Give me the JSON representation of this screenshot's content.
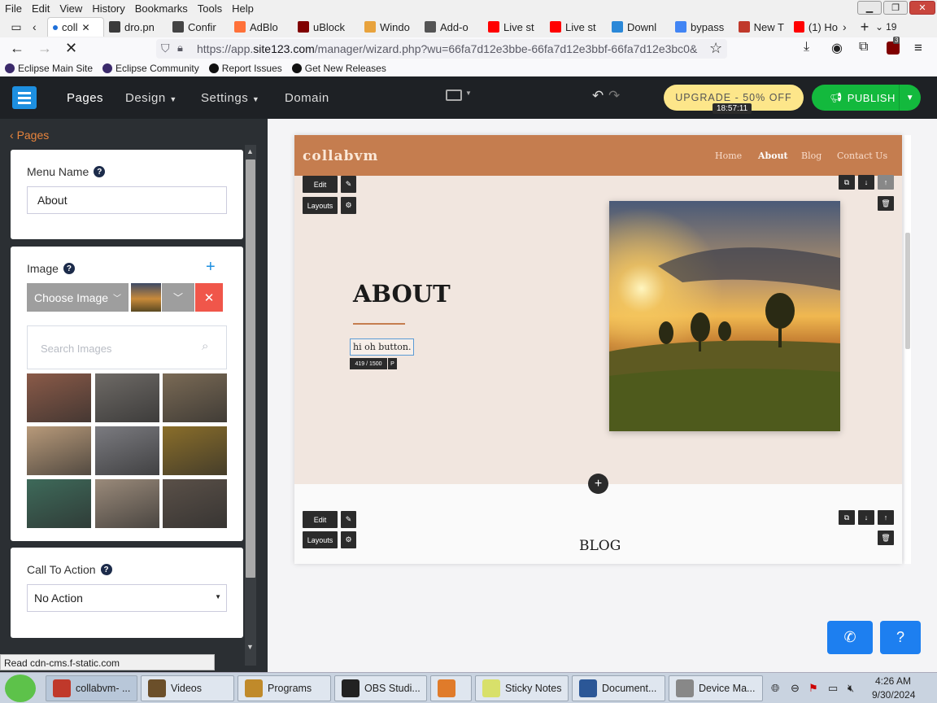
{
  "menubar": {
    "items": [
      "File",
      "Edit",
      "View",
      "History",
      "Bookmarks",
      "Tools",
      "Help"
    ]
  },
  "tabs": [
    {
      "label": "coll",
      "active": true,
      "color": "#1e6fd9"
    },
    {
      "label": "dro.pn",
      "color": "#3a3a3a"
    },
    {
      "label": "Confir",
      "color": "#444"
    },
    {
      "label": "AdBlo",
      "color": "#ff7139"
    },
    {
      "label": "uBlock",
      "color": "#800000"
    },
    {
      "label": "Windo",
      "color": "#e8a33d"
    },
    {
      "label": "Add-o",
      "color": "#555"
    },
    {
      "label": "Live st",
      "color": "#ff0000"
    },
    {
      "label": "Live st",
      "color": "#ff0000"
    },
    {
      "label": "Downl",
      "color": "#2b88d8"
    },
    {
      "label": "bypass",
      "color": "#4285f4"
    },
    {
      "label": "New T",
      "color": "#c0392b"
    },
    {
      "label": "(1) Ho",
      "color": "#ff0000"
    }
  ],
  "tab_count": "19",
  "url": {
    "prefix": "https://app.",
    "domain": "site123.com",
    "path": "/manager/wizard.php?wu=66fa7d12e3bbe-66fa7d12e3bbf-66fa7d12e3bc0&"
  },
  "ublock_badge": "3",
  "bookmarks": [
    {
      "label": "Eclipse Main Site",
      "color": "#3b2a6b"
    },
    {
      "label": "Eclipse Community",
      "color": "#3b2a6b"
    },
    {
      "label": "Report Issues",
      "color": "#111"
    },
    {
      "label": "Get New Releases",
      "color": "#111"
    }
  ],
  "app": {
    "nav": [
      "Pages",
      "Design",
      "Settings",
      "Domain"
    ],
    "upgrade_label": "UPGRADE - 50% OFF",
    "timer": "18:57:11",
    "publish_label": "PUBLISH"
  },
  "panel": {
    "back_label": "Pages",
    "menu_name_label": "Menu Name",
    "menu_name_value": "About",
    "image_label": "Image",
    "choose_image": "Choose Image",
    "search_placeholder": "Search Images",
    "thumb_colors": [
      "#8a5a48",
      "#6e6a66",
      "#7a6a55",
      "#b89a7a",
      "#7b7b80",
      "#8a6e2a",
      "#3e6a5a",
      "#9a8a7a",
      "#5a5048"
    ],
    "cta_label": "Call To Action",
    "cta_value": "No Action"
  },
  "site": {
    "brand": "collabvm",
    "nav": [
      "Home",
      "About",
      "Blog",
      "Contact Us"
    ],
    "heading": "ABOUT",
    "body_text": "hi oh button.",
    "char_count": "419 / 1500",
    "edit_label": "Edit",
    "layouts_label": "Layouts",
    "blog_heading": "BLOG"
  },
  "statusbar": "Read cdn-cms.f-static.com",
  "taskbar": {
    "items": [
      {
        "label": "collabvm- ...",
        "color": "#c0392b"
      },
      {
        "label": "Videos",
        "color": "#6b4f2a"
      },
      {
        "label": "Programs",
        "color": "#c08a2a"
      },
      {
        "label": "OBS Studi...",
        "color": "#222"
      },
      {
        "label": "",
        "color": "#e07b2a"
      },
      {
        "label": "Sticky Notes",
        "color": "#d8e06a"
      },
      {
        "label": "Document...",
        "color": "#2b5797"
      },
      {
        "label": "Device Ma...",
        "color": "#888"
      }
    ],
    "time": "4:26 AM",
    "date": "9/30/2024"
  }
}
